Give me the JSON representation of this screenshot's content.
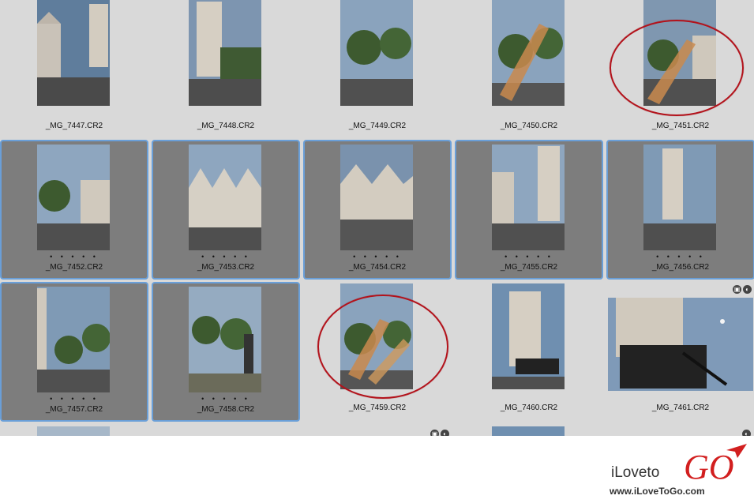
{
  "browser": {
    "rows": [
      [
        {
          "file": "_MG_7447.CR2",
          "selected": false,
          "rating": ""
        },
        {
          "file": "_MG_7448.CR2",
          "selected": false,
          "rating": ""
        },
        {
          "file": "_MG_7449.CR2",
          "selected": false,
          "rating": ""
        },
        {
          "file": "_MG_7450.CR2",
          "selected": false,
          "rating": ""
        },
        {
          "file": "_MG_7451.CR2",
          "selected": false,
          "rating": ""
        }
      ],
      [
        {
          "file": "_MG_7452.CR2",
          "selected": true,
          "rating": "• • • • •"
        },
        {
          "file": "_MG_7453.CR2",
          "selected": true,
          "rating": "• • • • •"
        },
        {
          "file": "_MG_7454.CR2",
          "selected": true,
          "rating": "• • • • •"
        },
        {
          "file": "_MG_7455.CR2",
          "selected": true,
          "rating": "• • • • •"
        },
        {
          "file": "_MG_7456.CR2",
          "selected": true,
          "rating": "• • • • •"
        }
      ],
      [
        {
          "file": "_MG_7457.CR2",
          "selected": true,
          "rating": "• • • • •"
        },
        {
          "file": "_MG_7458.CR2",
          "selected": true,
          "rating": "• • • • •"
        },
        {
          "file": "_MG_7459.CR2",
          "selected": false,
          "rating": ""
        },
        {
          "file": "_MG_7460.CR2",
          "selected": false,
          "rating": ""
        },
        {
          "file": "_MG_7461.CR2",
          "selected": false,
          "rating": ""
        }
      ]
    ],
    "badge_icons": [
      "crop-icon",
      "adjust-icon"
    ],
    "accent_color": "#6a9fd8",
    "annotation_color": "#b3121b"
  },
  "watermark": {
    "brand_prefix": "iLoveto",
    "brand_go": "GO",
    "url": "www.iLoveToGo.com"
  }
}
